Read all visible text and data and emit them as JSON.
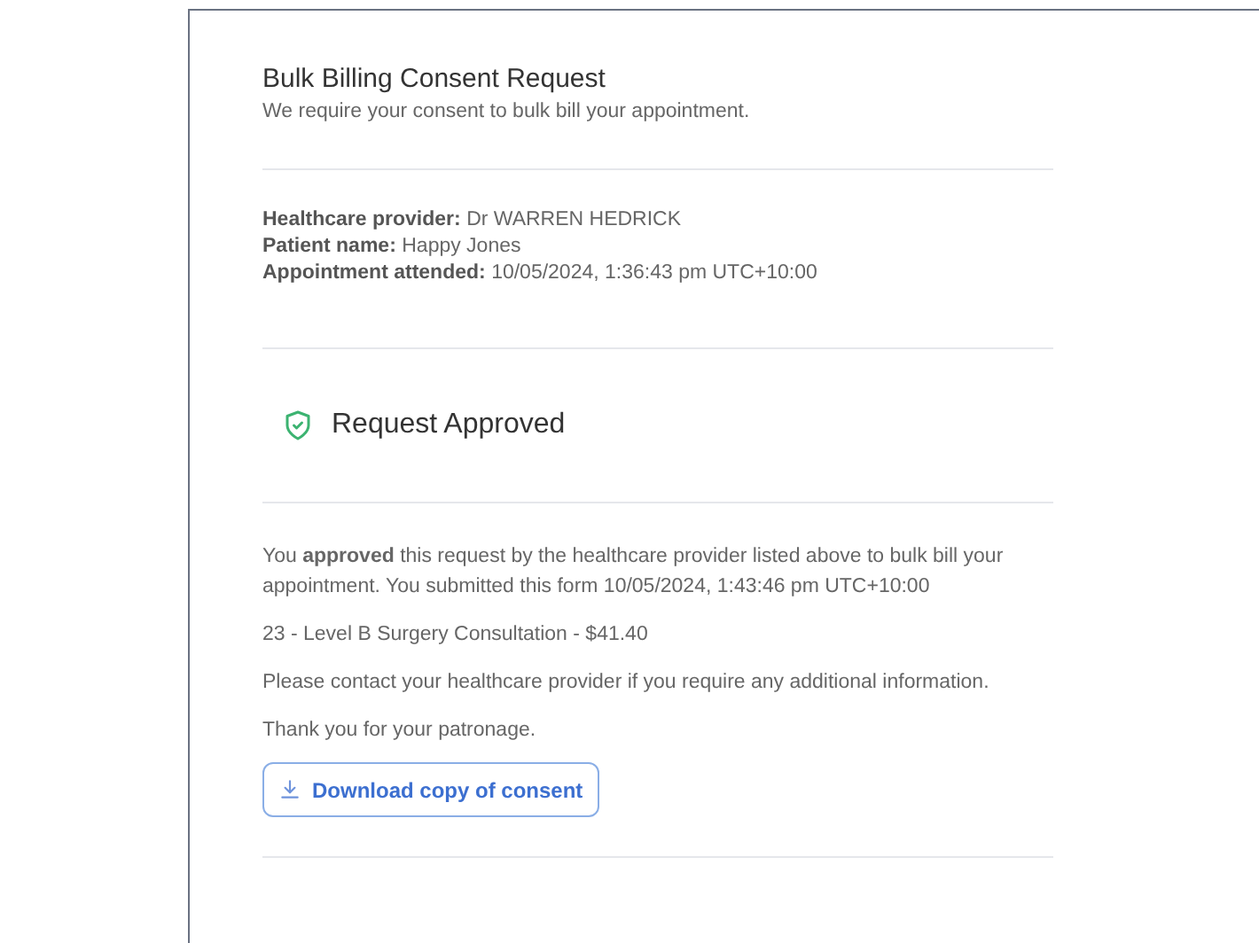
{
  "header": {
    "title": "Bulk Billing Consent Request",
    "subtitle": "We require your consent to bulk bill your appointment."
  },
  "details": [
    {
      "label": "Healthcare provider:",
      "value": "Dr WARREN HEDRICK"
    },
    {
      "label": "Patient name:",
      "value": "Happy Jones"
    },
    {
      "label": "Appointment attended:",
      "value": "10/05/2024, 1:36:43 pm UTC+10:00"
    }
  ],
  "status": {
    "title": "Request Approved"
  },
  "body": {
    "paragraphs": [
      "You **approved** this request by the healthcare provider listed above to bulk bill your appointment. You submitted this form 10/05/2024, 1:43:46 pm UTC+10:00",
      "23 - Level B Surgery Consultation - $41.40",
      "Please contact your healthcare provider if you require any additional information.",
      "Thank you for your patronage."
    ],
    "download_button": "Download copy of consent"
  }
}
